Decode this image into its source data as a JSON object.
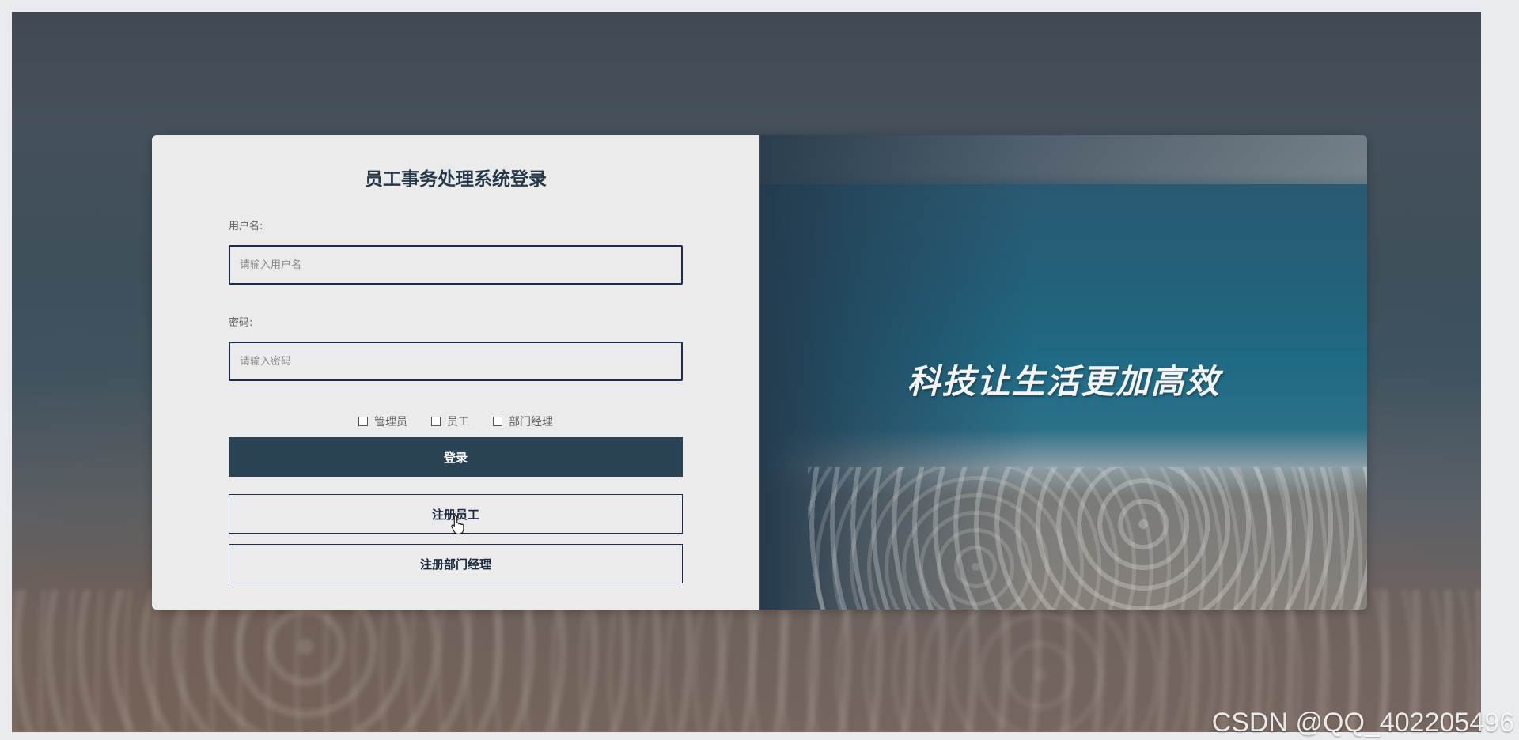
{
  "login": {
    "title": "员工事务处理系统登录",
    "username_label": "用户名:",
    "username_placeholder": "请输入用户名",
    "password_label": "密码:",
    "password_placeholder": "请输入密码",
    "roles": [
      "管理员",
      "员工",
      "部门经理"
    ],
    "login_button": "登录",
    "register_employee_button": "注册员工",
    "register_manager_button": "注册部门经理"
  },
  "banner": {
    "slogan": "科技让生活更加高效"
  },
  "watermark": "CSDN @QQ_402205496",
  "colors": {
    "primary": "#294355",
    "title": "#26384a",
    "input_border": "#1e2d4d",
    "panel": "#ebebeb"
  },
  "icons": {
    "cursor": "hand-pointer-icon"
  }
}
